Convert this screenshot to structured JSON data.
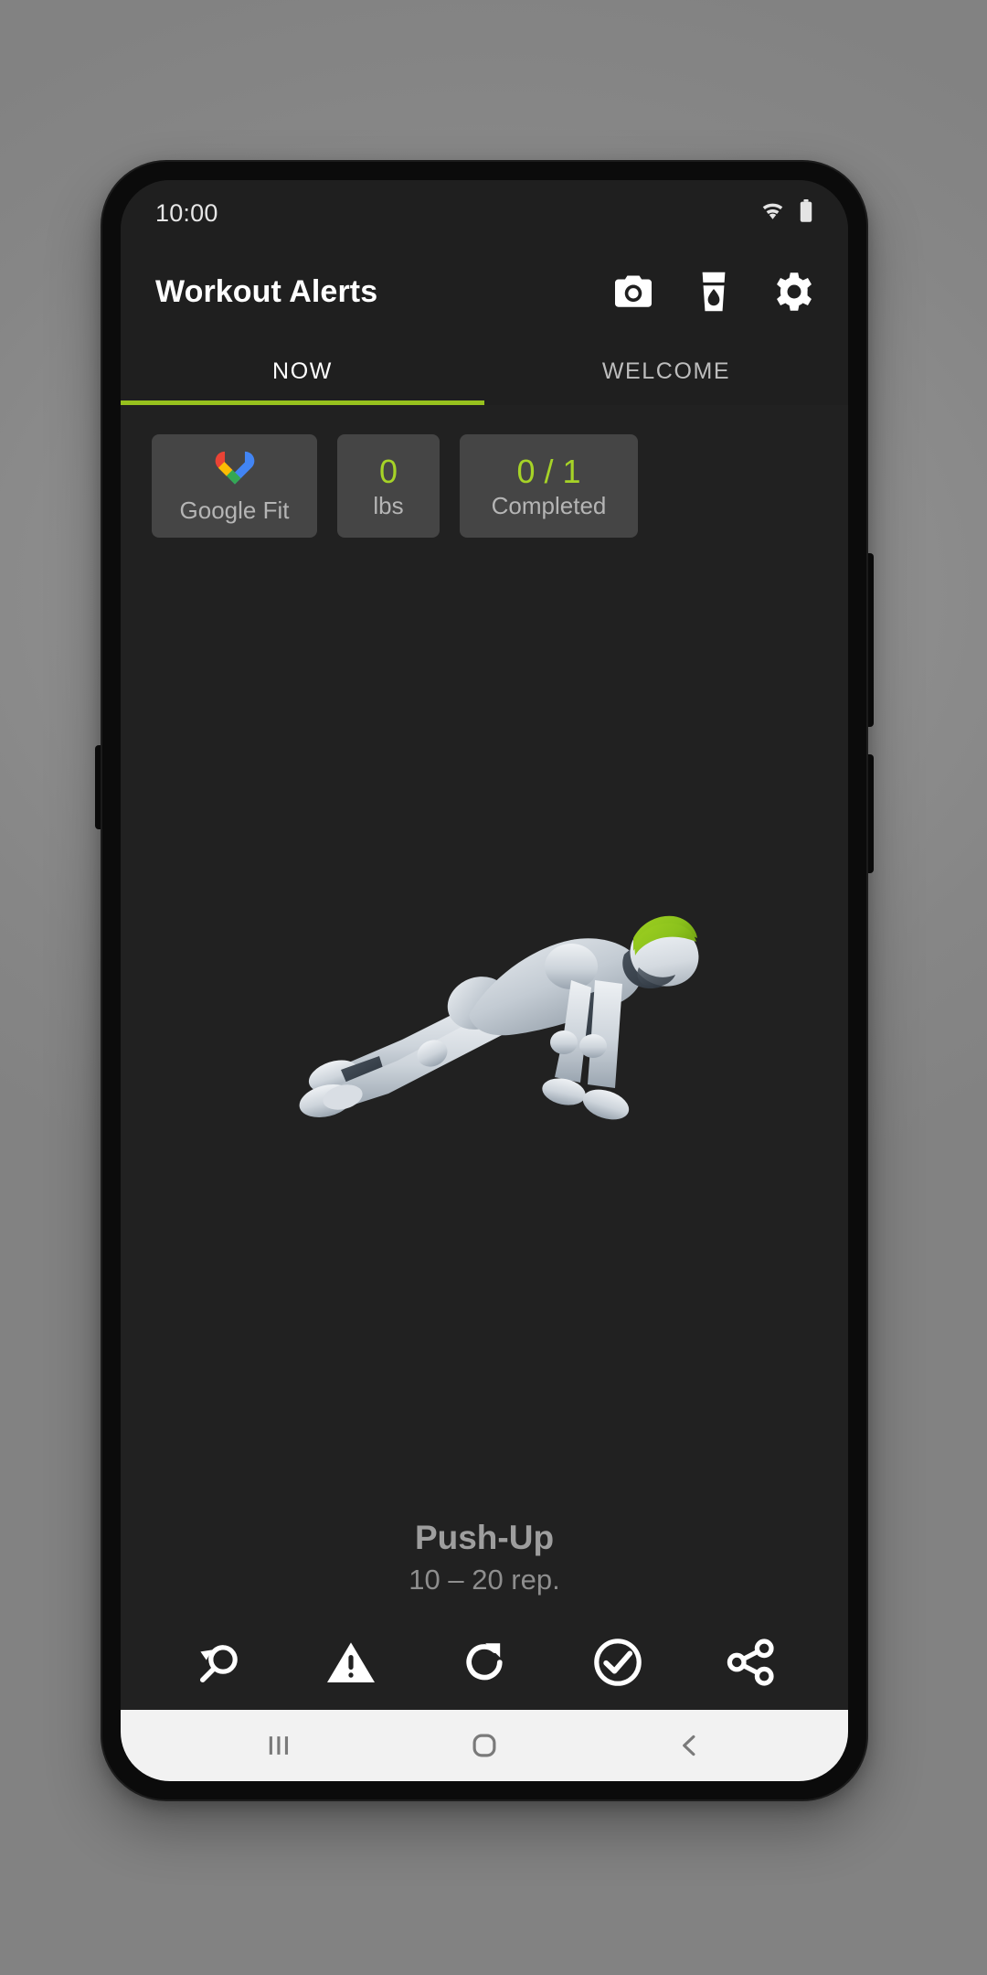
{
  "status_bar": {
    "time": "10:00",
    "icons": [
      "wifi-icon",
      "battery-icon"
    ]
  },
  "app_bar": {
    "title": "Workout Alerts",
    "actions": [
      {
        "name": "camera-icon",
        "label": "Camera"
      },
      {
        "name": "water-glass-icon",
        "label": "Hydration"
      },
      {
        "name": "gear-icon",
        "label": "Settings"
      }
    ]
  },
  "tabs": {
    "items": [
      {
        "label": "NOW",
        "active": true
      },
      {
        "label": "WELCOME",
        "active": false
      }
    ],
    "indicator_color": "#97c11e"
  },
  "stats": [
    {
      "name": "google-fit-card",
      "icon": "google-fit-heart-icon",
      "value": "",
      "label": "Google Fit"
    },
    {
      "name": "weight-card",
      "icon": "",
      "value": "0",
      "label": "lbs"
    },
    {
      "name": "completed-card",
      "icon": "",
      "value": "0 / 1",
      "label": "Completed"
    }
  ],
  "exercise": {
    "name": "Push-Up",
    "reps": "10 – 20 rep.",
    "figure": "push-up-mannequin"
  },
  "toolbar": [
    {
      "name": "search-back-icon",
      "label": "Previous"
    },
    {
      "name": "warning-triangle-icon",
      "label": "Alert"
    },
    {
      "name": "refresh-icon",
      "label": "Repeat"
    },
    {
      "name": "check-circle-icon",
      "label": "Done"
    },
    {
      "name": "share-icon",
      "label": "Share"
    }
  ],
  "nav_bar": [
    {
      "name": "recents-icon",
      "label": "Recents"
    },
    {
      "name": "home-icon",
      "label": "Home"
    },
    {
      "name": "back-icon",
      "label": "Back"
    }
  ],
  "colors": {
    "accent_green": "#97c11e",
    "stat_green": "#a6d327",
    "screen_bg": "#212121",
    "card_bg": "#454545",
    "headband_green": "#8fc31f"
  }
}
